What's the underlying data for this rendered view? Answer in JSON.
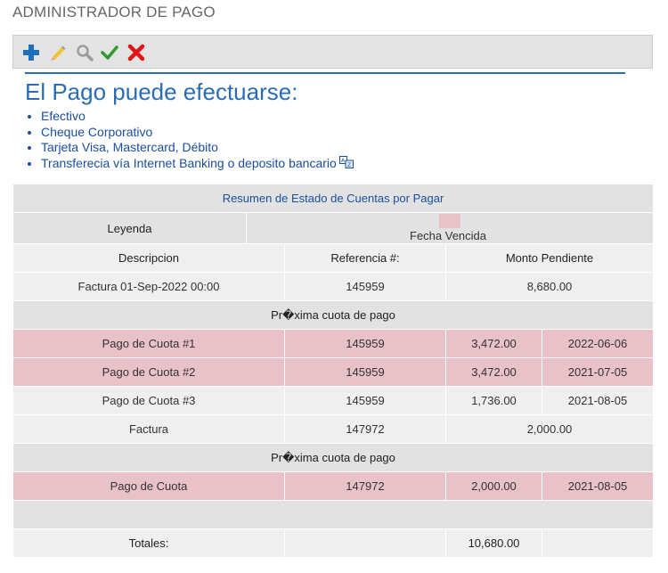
{
  "page": {
    "title": "ADMINISTRADOR DE PAGO"
  },
  "toolbar": {
    "buttons": [
      {
        "name": "add-icon",
        "color": "#1e6fc0"
      },
      {
        "name": "edit-pencil-icon",
        "color": "#e7b51c"
      },
      {
        "name": "search-magnifier-icon",
        "color": "#9c9c9c"
      },
      {
        "name": "check-icon",
        "color": "#2f9a2f"
      },
      {
        "name": "delete-x-icon",
        "color": "#e01616"
      }
    ]
  },
  "payment_info": {
    "heading": "El Pago puede efectuarse:",
    "methods": [
      "Efectivo",
      "Cheque Corporativo",
      "Tarjeta Visa, Mastercard, Débito",
      "Transferecia vía Internet Banking o deposito bancario"
    ]
  },
  "summary": {
    "title": "Resumen de Estado de Cuentas por Pagar",
    "legend_label": "Leyenda",
    "legend_item": "Fecha Vencida",
    "overdue_color": "#e8c2c8",
    "col_headers": [
      "Descripcion",
      "Referencia #:",
      "Monto Pendiente"
    ],
    "invoices": [
      {
        "description": "Factura 01-Sep-2022 00:00",
        "reference": "145959",
        "amount": "8,680.00",
        "section_label": "Pr�xima cuota de pago",
        "installments": [
          {
            "description": "Pago de Cuota #1",
            "reference": "145959",
            "amount": "3,472.00",
            "date": "2022-06-06"
          },
          {
            "description": "Pago de Cuota #2",
            "reference": "145959",
            "amount": "3,472.00",
            "date": "2021-07-05"
          },
          {
            "description": "Pago de Cuota #3",
            "reference": "145959",
            "amount": "1,736.00",
            "date": "2021-08-05"
          }
        ]
      },
      {
        "description": "Factura",
        "reference": "147972",
        "amount": "2,000.00",
        "section_label": "Pr�xima cuota de pago",
        "installments": [
          {
            "description": "Pago de Cuota",
            "reference": "147972",
            "amount": "2,000.00",
            "date": "2021-08-05"
          }
        ]
      }
    ],
    "totals_label": "Totales:",
    "totals_amount": "10,680.00"
  }
}
